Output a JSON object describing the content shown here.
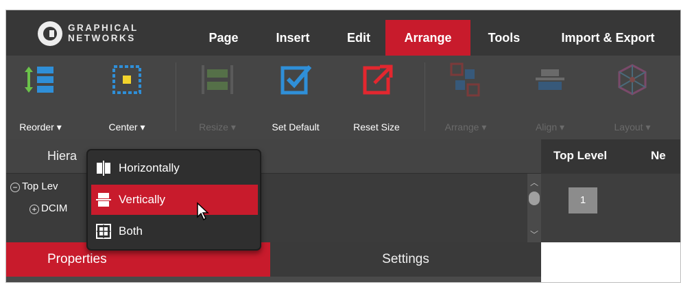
{
  "app": {
    "logo_text_line1": "GRAPHICAL",
    "logo_text_line2": "NETWORKS"
  },
  "menu": {
    "tabs": [
      {
        "label": "Page",
        "active": false
      },
      {
        "label": "Insert",
        "active": false
      },
      {
        "label": "Edit",
        "active": false
      },
      {
        "label": "Arrange",
        "active": true
      },
      {
        "label": "Tools",
        "active": false
      },
      {
        "label": "Import & Export",
        "active": false
      }
    ]
  },
  "ribbon": {
    "buttons": [
      {
        "label": "Reorder ▾",
        "icon": "reorder-icon",
        "enabled": true
      },
      {
        "label": "Center ▾",
        "icon": "center-icon",
        "enabled": true
      },
      {
        "label": "Resize ▾",
        "icon": "resize-icon",
        "enabled": false
      },
      {
        "label": "Set Default",
        "icon": "set-default-icon",
        "enabled": true
      },
      {
        "label": "Reset Size",
        "icon": "reset-size-icon",
        "enabled": true
      },
      {
        "label": "Arrange ▾",
        "icon": "arrange-icon",
        "enabled": false
      },
      {
        "label": "Align ▾",
        "icon": "align-icon",
        "enabled": false
      },
      {
        "label": "Layout ▾",
        "icon": "layout-icon",
        "enabled": false
      }
    ]
  },
  "center_menu": {
    "items": [
      {
        "label": "Horizontally",
        "icon": "center-horizontally-icon",
        "active": false
      },
      {
        "label": "Vertically",
        "icon": "center-vertically-icon",
        "active": true
      },
      {
        "label": "Both",
        "icon": "center-both-icon",
        "active": false
      }
    ]
  },
  "hierarchy": {
    "title": "Hiera",
    "rows": [
      {
        "toggle": "−",
        "label": "Top Lev"
      },
      {
        "toggle": "+",
        "label": "DCIM"
      }
    ]
  },
  "bottom_tabs": {
    "properties": "Properties",
    "settings": "Settings"
  },
  "right_panel": {
    "header_left": "Top Level",
    "header_right": "Ne",
    "page_number": "1"
  },
  "colors": {
    "accent": "#c81b2c",
    "menubar": "#373737",
    "ribbon": "#454545"
  }
}
